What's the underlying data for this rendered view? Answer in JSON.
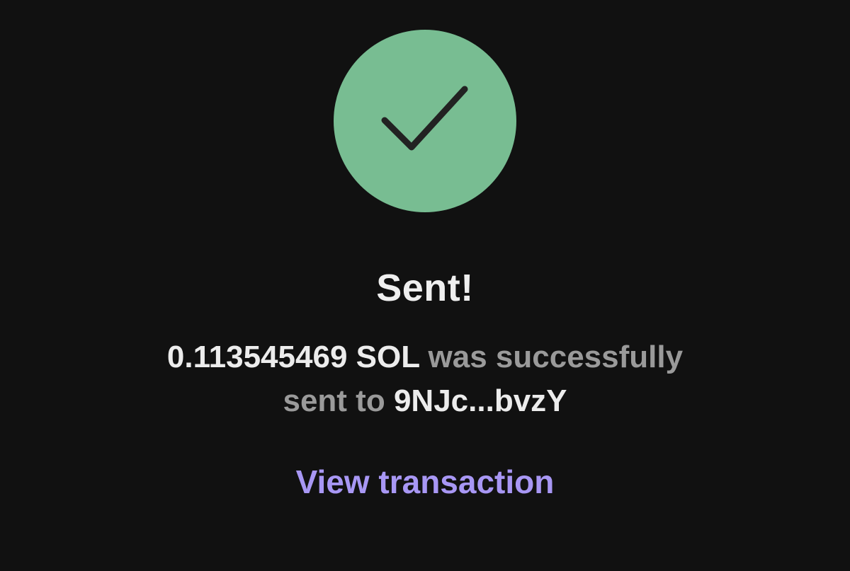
{
  "status": {
    "icon": "checkmark-icon",
    "success_color": "#78bd92",
    "title": "Sent!"
  },
  "message": {
    "amount": "0.113545469 SOL",
    "connector_1": "was successfully",
    "connector_2": "sent to",
    "recipient": "9NJc...bvzY"
  },
  "actions": {
    "view_transaction_label": "View transaction",
    "link_color": "#a897f4"
  }
}
